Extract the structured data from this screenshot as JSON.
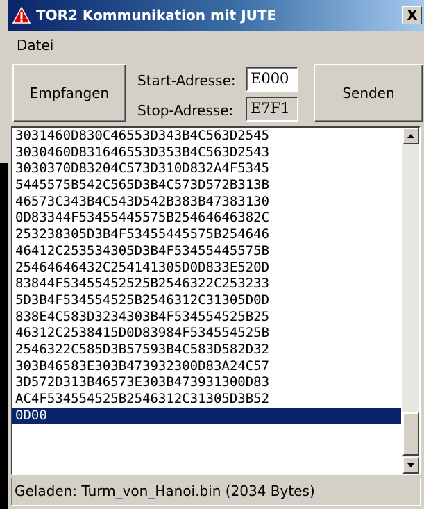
{
  "window": {
    "title": "TOR2 Kommunikation mit JUTE",
    "close_label": "X",
    "warning_icon": "warning-icon"
  },
  "menu": {
    "file_label": "Datei"
  },
  "controls": {
    "receive_label": "Empfangen",
    "send_label": "Senden",
    "start_label": "Start-Adresse:",
    "start_value": "E000",
    "stop_label": "Stop-Adresse:",
    "stop_value": "E7F1"
  },
  "hex_lines": [
    "3031460D830C46553D343B4C563D2545",
    "3030460D831646553D353B4C563D2543",
    "3030370D83204C573D310D832A4F5345",
    "5445575B542C565D3B4C573D572B313B",
    "46573C343B4C543D542B383B47383130",
    "0D83344F53455445575B25464646382C",
    "253238305D3B4F53455445575B254646",
    "46412C253534305D3B4F53455445575B",
    "25464646432C254141305D0D833E520D",
    "83844F53455452525B2546322C253233",
    "5D3B4F534554525B2546312C31305D0D",
    "838E4C583D3234303B4F534554525B25",
    "46312C2538415D0D83984F534554525B",
    "2546322C585D3B57593B4C583D582D32",
    "303B46583E303B473932300D83A24C57",
    "3D572D313B46573E303B473931300D83",
    "AC4F534554525B2546312C31305D3B52",
    "0D00"
  ],
  "selected_index": 17,
  "status": {
    "text": "Geladen: Turm_von_Hanoi.bin (2034 Bytes)"
  },
  "colors": {
    "selection": "#0a246a",
    "titlebar": "#0a246a",
    "face": "#d4d0c8"
  }
}
